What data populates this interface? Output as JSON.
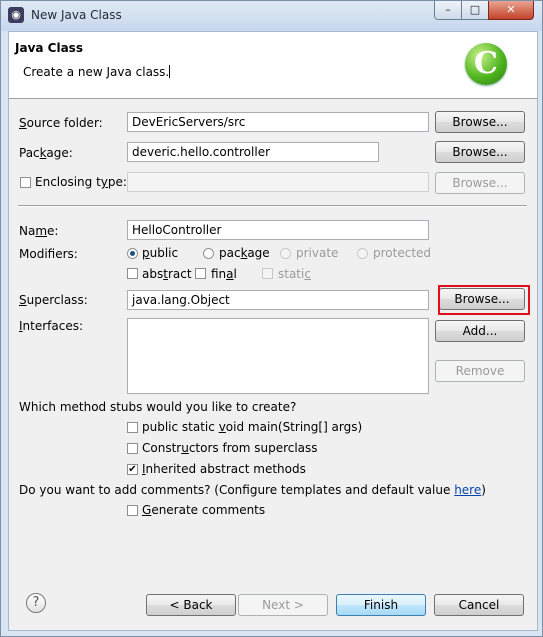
{
  "window": {
    "title": "New Java Class",
    "app_icon": "eclipse-icon",
    "controls": {
      "minimize": "–",
      "maximize": "□",
      "close": "✕"
    }
  },
  "banner": {
    "title": "Java Class",
    "message": "Create a new Java class.",
    "logo_glyph": "C"
  },
  "source_folder": {
    "label_pre": "",
    "label_key": "S",
    "label_post": "ource folder:",
    "value": "DevEricServers/src",
    "browse_label": "Browse...",
    "browse_enabled": true
  },
  "package": {
    "label_pre": "Pac",
    "label_key": "k",
    "label_post": "age:",
    "value": "deveric.hello.controller",
    "browse_label": "Browse...",
    "browse_enabled": true
  },
  "enclosing_type": {
    "label_pre": "Enclosing t",
    "label_key": "y",
    "label_post": "pe:",
    "checked": false,
    "value": "",
    "browse_label": "Browse...",
    "browse_enabled": false
  },
  "name": {
    "label_pre": "Na",
    "label_key": "m",
    "label_post": "e:",
    "value": "HelloController"
  },
  "modifiers": {
    "label": "Modifiers:",
    "access": [
      {
        "key": "p",
        "rest": "ublic",
        "selected": true,
        "enabled": true
      },
      {
        "key": "",
        "rest": "package",
        "pre": "pac",
        "keyc": "k",
        "post": "age",
        "selected": false,
        "enabled": true
      },
      {
        "label": "private",
        "selected": false,
        "enabled": false
      },
      {
        "label": "protected",
        "selected": false,
        "enabled": false
      }
    ],
    "abstract": {
      "pre": "abs",
      "key": "t",
      "post": "ract",
      "checked": false,
      "enabled": true
    },
    "final": {
      "pre": "fin",
      "key": "a",
      "post": "l",
      "checked": false,
      "enabled": true
    },
    "static": {
      "pre": "stati",
      "key": "c",
      "post": "",
      "checked": false,
      "enabled": false
    }
  },
  "superclass": {
    "label_pre": "",
    "label_key": "S",
    "label_post": "uperclass:",
    "value": "java.lang.Object",
    "browse_label": "Browse...",
    "highlighted": true
  },
  "interfaces": {
    "label_pre": "",
    "label_key": "I",
    "label_post": "nterfaces:",
    "items": [],
    "add_label": "Add...",
    "remove_label": "Remove",
    "remove_enabled": false
  },
  "stubs": {
    "question": "Which method stubs would you like to create?",
    "options": [
      {
        "pre": "public static ",
        "key": "v",
        "post": "oid main(String[] args)",
        "checked": false
      },
      {
        "pre": "Constr",
        "key": "u",
        "post": "ctors from superclass",
        "checked": false
      },
      {
        "pre": "",
        "key": "I",
        "post": "nherited abstract methods",
        "checked": true
      }
    ]
  },
  "comments": {
    "question_pre": "Do you want to add comments? (Configure templates and default value ",
    "link": "here",
    "question_post": ")",
    "option": {
      "pre": "",
      "key": "G",
      "post": "enerate comments",
      "checked": false
    }
  },
  "footer": {
    "help_glyph": "?",
    "back_label": "< Back",
    "back_key": "B",
    "next_label": "Next >",
    "finish_label": "Finish",
    "cancel_label": "Cancel"
  },
  "colors": {
    "highlight_border": "#e0101a",
    "link": "#0645ad",
    "default_button": "#3c7fb1"
  }
}
